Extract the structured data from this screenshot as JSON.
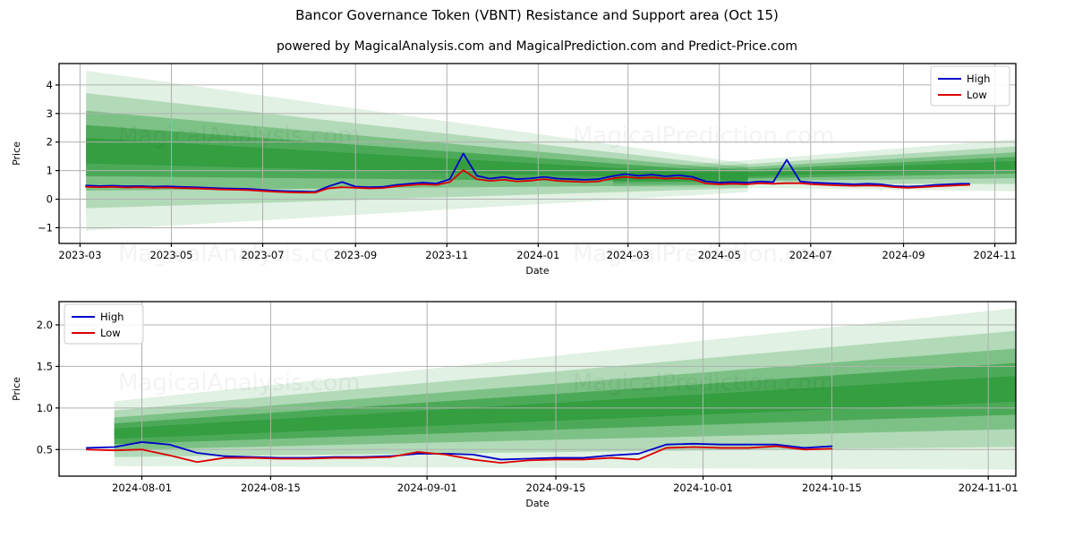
{
  "header": {
    "title": "Bancor Governance Token (VBNT) Resistance and Support area (Oct 15)",
    "subtitle": "powered by MagicalAnalysis.com and MagicalPrediction.com and Predict-Price.com"
  },
  "watermarks": {
    "analysis": "MagicalAnalysis.com",
    "prediction": "MagicalPrediction.com"
  },
  "colors": {
    "high": "#0000cc",
    "low": "#dd0000",
    "band": "#2e9b3c",
    "grid": "#b0b0b0",
    "axis": "#000000",
    "background": "#ffffff"
  },
  "chart_data": [
    {
      "type": "line",
      "id": "top",
      "title": "Bancor Governance Token (VBNT) Resistance and Support area (Oct 15)",
      "xlabel": "Date",
      "ylabel": "Price",
      "grid": true,
      "legend_position": "upper right",
      "ylim": [
        -1.55,
        4.75
      ],
      "yticks": [
        -1,
        0,
        1,
        2,
        3,
        4
      ],
      "ytick_labels": [
        "−1",
        "0",
        "1",
        "2",
        "3",
        "4"
      ],
      "xlim": [
        "2023-02-15",
        "2024-11-15"
      ],
      "xticks": [
        "2023-03",
        "2023-05",
        "2023-07",
        "2023-09",
        "2023-11",
        "2024-01",
        "2024-03",
        "2024-05",
        "2024-07",
        "2024-09",
        "2024-11"
      ],
      "series": [
        {
          "name": "High",
          "color": "#0000cc",
          "x": [
            "2023-03-05",
            "2023-03-14",
            "2023-03-23",
            "2023-04-01",
            "2023-04-10",
            "2023-04-19",
            "2023-04-28",
            "2023-05-07",
            "2023-05-16",
            "2023-05-25",
            "2023-06-03",
            "2023-06-12",
            "2023-06-21",
            "2023-06-30",
            "2023-07-09",
            "2023-07-18",
            "2023-07-27",
            "2023-08-05",
            "2023-08-14",
            "2023-08-23",
            "2023-09-01",
            "2023-09-10",
            "2023-09-19",
            "2023-09-28",
            "2023-10-07",
            "2023-10-16",
            "2023-10-25",
            "2023-11-03",
            "2023-11-12",
            "2023-11-21",
            "2023-11-30",
            "2023-12-09",
            "2023-12-18",
            "2023-12-27",
            "2024-01-05",
            "2024-01-14",
            "2024-01-23",
            "2024-02-01",
            "2024-02-10",
            "2024-02-19",
            "2024-02-28",
            "2024-03-08",
            "2024-03-17",
            "2024-03-26",
            "2024-04-04",
            "2024-04-13",
            "2024-04-22",
            "2024-05-01",
            "2024-05-10",
            "2024-05-19",
            "2024-05-28",
            "2024-06-06",
            "2024-06-15",
            "2024-06-24",
            "2024-07-03",
            "2024-07-12",
            "2024-07-21",
            "2024-07-30",
            "2024-08-08",
            "2024-08-17",
            "2024-08-26",
            "2024-09-04",
            "2024-09-13",
            "2024-09-22",
            "2024-10-01",
            "2024-10-10",
            "2024-10-15"
          ],
          "values": [
            0.48,
            0.46,
            0.47,
            0.45,
            0.46,
            0.44,
            0.45,
            0.43,
            0.42,
            0.4,
            0.38,
            0.37,
            0.36,
            0.33,
            0.3,
            0.28,
            0.27,
            0.26,
            0.45,
            0.6,
            0.44,
            0.42,
            0.43,
            0.5,
            0.54,
            0.58,
            0.55,
            0.7,
            1.6,
            0.82,
            0.72,
            0.78,
            0.7,
            0.73,
            0.78,
            0.72,
            0.7,
            0.68,
            0.7,
            0.8,
            0.88,
            0.82,
            0.86,
            0.8,
            0.84,
            0.78,
            0.62,
            0.58,
            0.6,
            0.58,
            0.62,
            0.6,
            1.38,
            0.62,
            0.58,
            0.56,
            0.54,
            0.52,
            0.54,
            0.52,
            0.46,
            0.44,
            0.46,
            0.5,
            0.52,
            0.54,
            0.54
          ]
        },
        {
          "name": "Low",
          "color": "#dd0000",
          "x": [
            "2023-03-05",
            "2023-03-14",
            "2023-03-23",
            "2023-04-01",
            "2023-04-10",
            "2023-04-19",
            "2023-04-28",
            "2023-05-07",
            "2023-05-16",
            "2023-05-25",
            "2023-06-03",
            "2023-06-12",
            "2023-06-21",
            "2023-06-30",
            "2023-07-09",
            "2023-07-18",
            "2023-07-27",
            "2023-08-05",
            "2023-08-14",
            "2023-08-23",
            "2023-09-01",
            "2023-09-10",
            "2023-09-19",
            "2023-09-28",
            "2023-10-07",
            "2023-10-16",
            "2023-10-25",
            "2023-11-03",
            "2023-11-12",
            "2023-11-21",
            "2023-11-30",
            "2023-12-09",
            "2023-12-18",
            "2023-12-27",
            "2024-01-05",
            "2024-01-14",
            "2024-01-23",
            "2024-02-01",
            "2024-02-10",
            "2024-02-19",
            "2024-02-28",
            "2024-03-08",
            "2024-03-17",
            "2024-03-26",
            "2024-04-04",
            "2024-04-13",
            "2024-04-22",
            "2024-05-01",
            "2024-05-10",
            "2024-05-19",
            "2024-05-28",
            "2024-06-06",
            "2024-06-15",
            "2024-06-24",
            "2024-07-03",
            "2024-07-12",
            "2024-07-21",
            "2024-07-30",
            "2024-08-08",
            "2024-08-17",
            "2024-08-26",
            "2024-09-04",
            "2024-09-13",
            "2024-09-22",
            "2024-10-01",
            "2024-10-10",
            "2024-10-15"
          ],
          "values": [
            0.43,
            0.42,
            0.43,
            0.41,
            0.42,
            0.4,
            0.41,
            0.39,
            0.38,
            0.36,
            0.34,
            0.33,
            0.32,
            0.29,
            0.26,
            0.24,
            0.23,
            0.23,
            0.38,
            0.42,
            0.4,
            0.38,
            0.39,
            0.45,
            0.49,
            0.52,
            0.5,
            0.6,
            1.02,
            0.7,
            0.64,
            0.68,
            0.62,
            0.65,
            0.7,
            0.64,
            0.62,
            0.6,
            0.62,
            0.72,
            0.78,
            0.74,
            0.76,
            0.72,
            0.74,
            0.7,
            0.55,
            0.52,
            0.54,
            0.52,
            0.56,
            0.54,
            0.56,
            0.56,
            0.52,
            0.5,
            0.48,
            0.47,
            0.48,
            0.47,
            0.42,
            0.4,
            0.42,
            0.45,
            0.47,
            0.49,
            0.5
          ]
        }
      ],
      "bands": {
        "description": "Nested green resistance/support areas: a converging cone from the left and a diverging cone toward the right",
        "left_cone": {
          "x_start": "2023-03-05",
          "x_end": "2024-05-20",
          "top_start": 4.5,
          "top_end": 1.25,
          "bottom_start": -1.1,
          "bottom_end": 0.25
        },
        "right_cone": {
          "x_start": "2024-02-20",
          "x_end": "2024-11-15",
          "top_start": 1.0,
          "top_end": 2.1,
          "bottom_start": 0.45,
          "bottom_end": 0.28
        },
        "levels": [
          {
            "opacity": 0.14,
            "half_width": 1.0
          },
          {
            "opacity": 0.26,
            "half_width": 0.72
          },
          {
            "opacity": 0.4,
            "half_width": 0.5
          },
          {
            "opacity": 0.62,
            "half_width": 0.32
          },
          {
            "opacity": 0.8,
            "half_width": 0.16
          }
        ]
      }
    },
    {
      "type": "line",
      "id": "bottom",
      "xlabel": "Date",
      "ylabel": "Price",
      "grid": true,
      "legend_position": "upper left",
      "ylim": [
        0.18,
        2.28
      ],
      "yticks": [
        0.5,
        1.0,
        1.5,
        2.0
      ],
      "ytick_labels": [
        "0.5",
        "1.0",
        "1.5",
        "2.0"
      ],
      "xlim": [
        "2024-07-23",
        "2024-11-04"
      ],
      "xticks": [
        "2024-08-01",
        "2024-08-15",
        "2024-09-01",
        "2024-09-15",
        "2024-10-01",
        "2024-10-15",
        "2024-11-01"
      ],
      "series": [
        {
          "name": "High",
          "color": "#0000cc",
          "x": [
            "2024-07-26",
            "2024-07-29",
            "2024-08-01",
            "2024-08-04",
            "2024-08-07",
            "2024-08-10",
            "2024-08-13",
            "2024-08-16",
            "2024-08-19",
            "2024-08-22",
            "2024-08-25",
            "2024-08-28",
            "2024-08-31",
            "2024-09-03",
            "2024-09-06",
            "2024-09-09",
            "2024-09-12",
            "2024-09-15",
            "2024-09-18",
            "2024-09-21",
            "2024-09-24",
            "2024-09-27",
            "2024-09-30",
            "2024-10-03",
            "2024-10-06",
            "2024-10-09",
            "2024-10-12",
            "2024-10-15"
          ],
          "values": [
            0.52,
            0.53,
            0.59,
            0.56,
            0.46,
            0.42,
            0.41,
            0.4,
            0.4,
            0.41,
            0.41,
            0.42,
            0.45,
            0.45,
            0.44,
            0.38,
            0.39,
            0.4,
            0.4,
            0.43,
            0.45,
            0.56,
            0.57,
            0.56,
            0.56,
            0.56,
            0.52,
            0.54
          ]
        },
        {
          "name": "Low",
          "color": "#dd0000",
          "x": [
            "2024-07-26",
            "2024-07-29",
            "2024-08-01",
            "2024-08-04",
            "2024-08-07",
            "2024-08-10",
            "2024-08-13",
            "2024-08-16",
            "2024-08-19",
            "2024-08-22",
            "2024-08-25",
            "2024-08-28",
            "2024-08-31",
            "2024-09-03",
            "2024-09-06",
            "2024-09-09",
            "2024-09-12",
            "2024-09-15",
            "2024-09-18",
            "2024-09-21",
            "2024-09-24",
            "2024-09-27",
            "2024-09-30",
            "2024-10-03",
            "2024-10-06",
            "2024-10-09",
            "2024-10-12",
            "2024-10-15"
          ],
          "values": [
            0.5,
            0.49,
            0.5,
            0.43,
            0.35,
            0.4,
            0.4,
            0.39,
            0.39,
            0.4,
            0.4,
            0.41,
            0.47,
            0.44,
            0.38,
            0.34,
            0.37,
            0.38,
            0.38,
            0.4,
            0.38,
            0.52,
            0.53,
            0.52,
            0.52,
            0.54,
            0.5,
            0.51
          ]
        }
      ],
      "bands": {
        "description": "Nested green resistance/support areas diverging toward the right",
        "cone": {
          "x_start": "2024-07-29",
          "x_end": "2024-11-04",
          "top_start": 1.08,
          "top_end": 2.2,
          "bottom_start": 0.3,
          "bottom_end": 0.26
        },
        "levels": [
          {
            "opacity": 0.14,
            "half_width": 1.0
          },
          {
            "opacity": 0.26,
            "half_width": 0.72
          },
          {
            "opacity": 0.4,
            "half_width": 0.5
          },
          {
            "opacity": 0.62,
            "half_width": 0.32
          },
          {
            "opacity": 0.8,
            "half_width": 0.16
          }
        ]
      }
    }
  ]
}
